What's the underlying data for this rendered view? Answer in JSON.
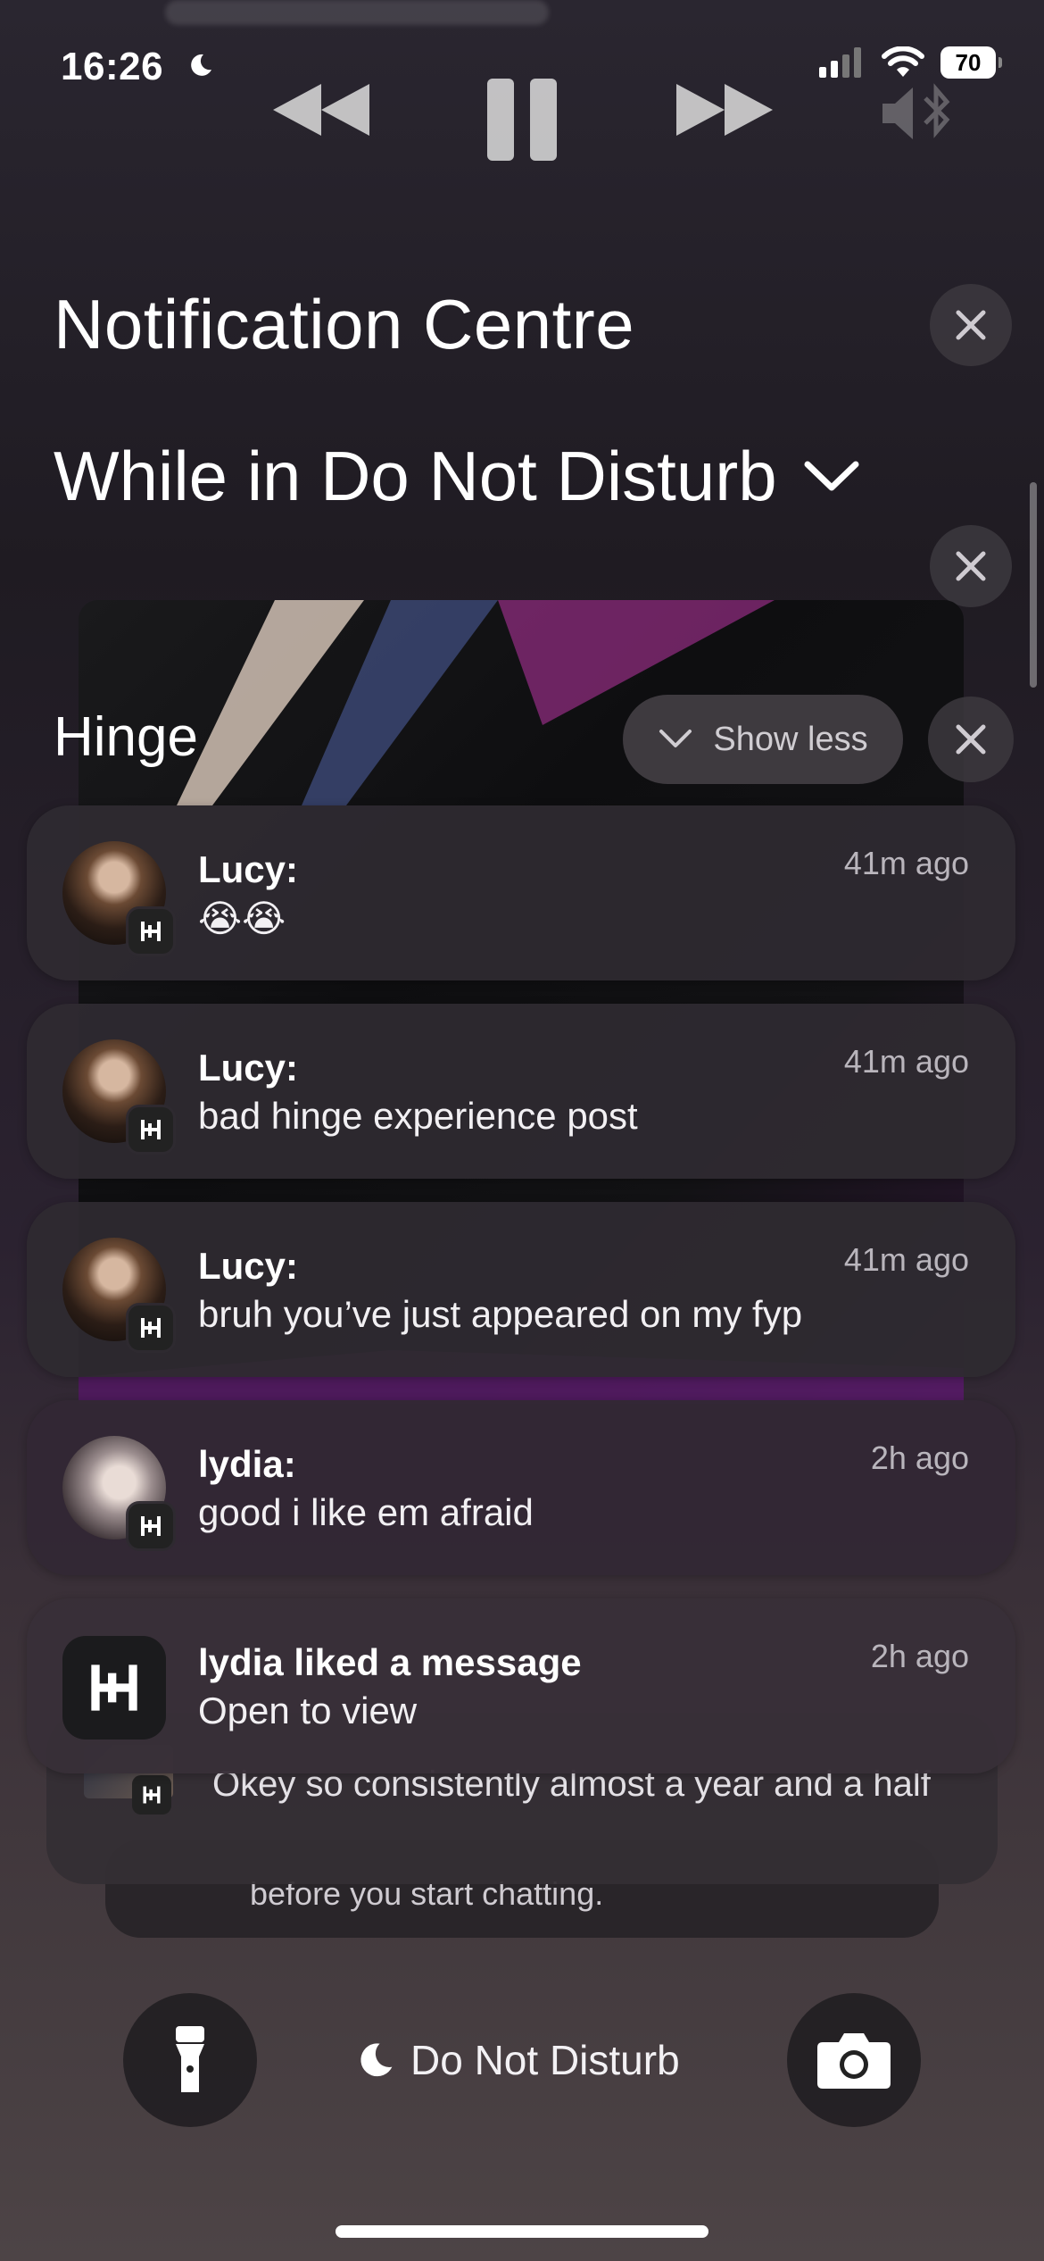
{
  "status_bar": {
    "time": "16:26",
    "battery": "70"
  },
  "notification_centre": {
    "title": "Notification Centre",
    "focus_section_title": "While in Do Not Disturb"
  },
  "group": {
    "app_name": "Hinge",
    "show_less_label": "Show less"
  },
  "notifications": [
    {
      "sender": "Lucy:",
      "message": "😭😭",
      "time": "41m ago"
    },
    {
      "sender": "Lucy:",
      "message": "bad hinge experience post",
      "time": "41m ago"
    },
    {
      "sender": "Lucy:",
      "message": "bruh you’ve just appeared on my fyp",
      "time": "41m ago"
    },
    {
      "sender": "lydia:",
      "message": "good i like em afraid",
      "time": "2h ago"
    },
    {
      "sender": "lydia liked a message",
      "message": "Open to view",
      "time": "2h ago"
    }
  ],
  "stacked": {
    "message": "Okey so consistently almost a year and a half",
    "message_behind": "before you start chatting."
  },
  "bottom": {
    "dnd_label": "Do Not Disturb"
  },
  "colors": {
    "card_bg": "#2e2a30",
    "badge_bg": "#222222",
    "secondary_text": "#b9b5bc"
  }
}
